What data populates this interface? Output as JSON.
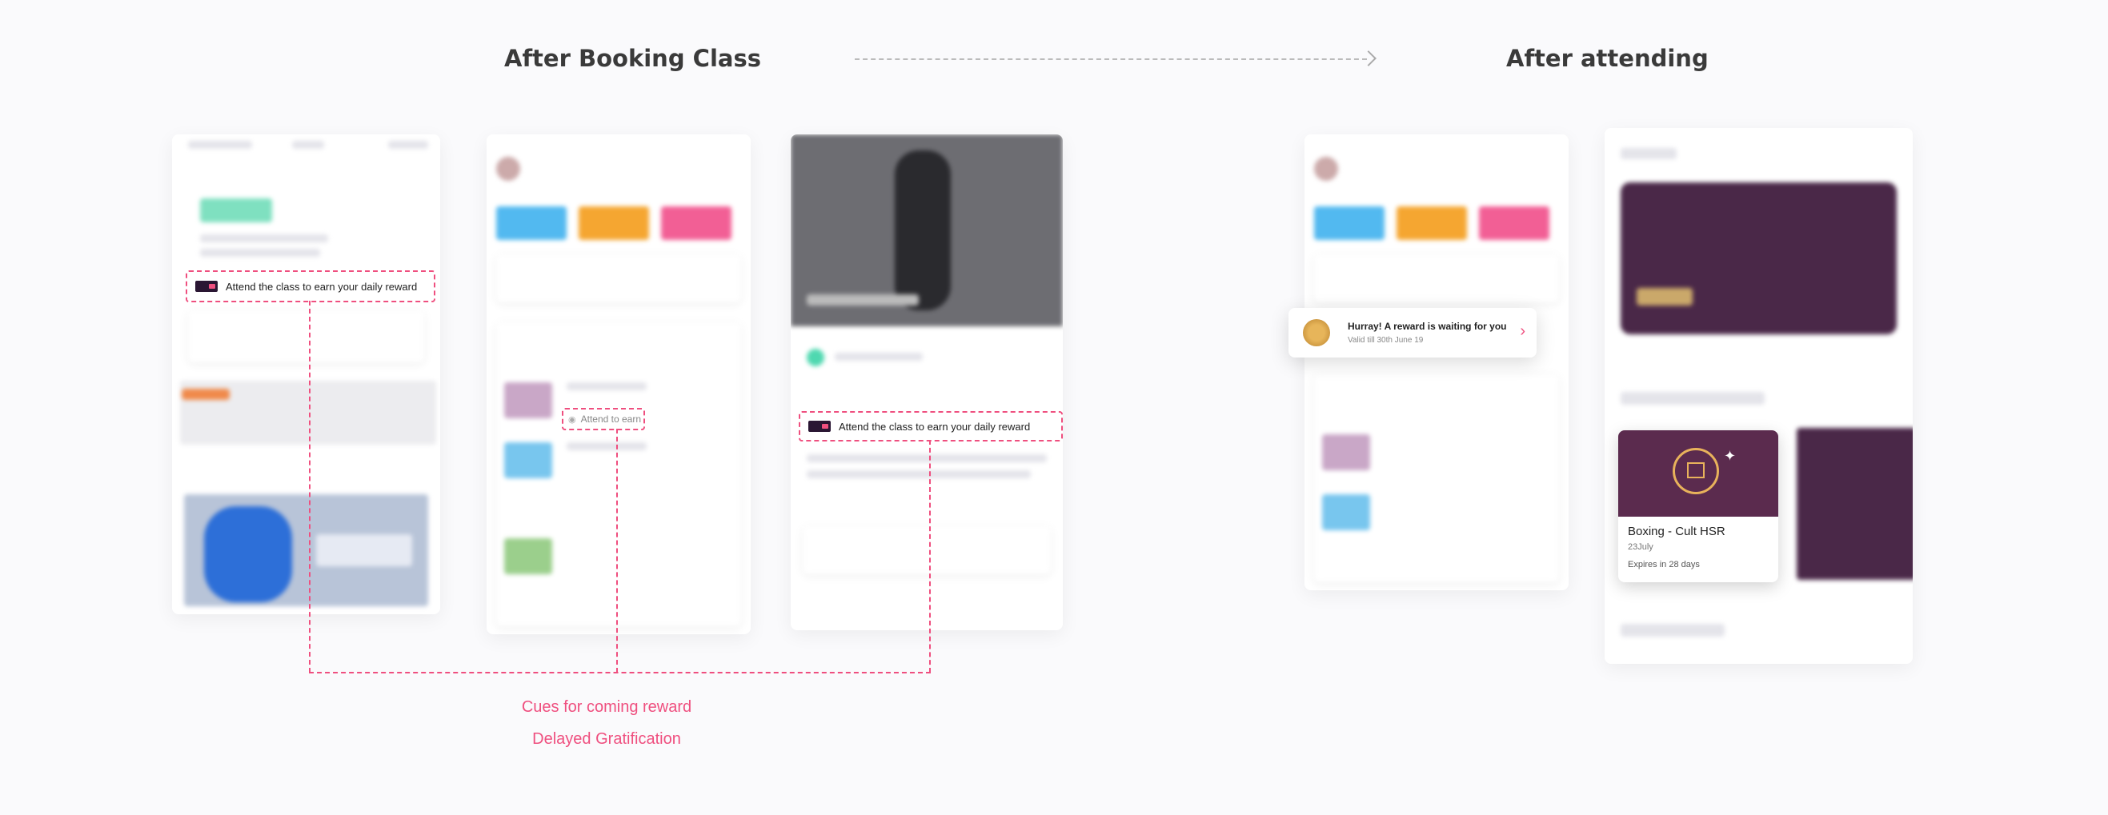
{
  "headings": {
    "after_booking": "After Booking Class",
    "after_attending": "After attending"
  },
  "cues": {
    "attend_earn_reward": "Attend the class to earn your daily reward",
    "attend_to_earn": "Attend to earn"
  },
  "captions": {
    "line1": "Cues for coming reward",
    "line2": "Delayed Gratification"
  },
  "toast": {
    "title": "Hurray! A reward is waiting for you",
    "subtitle": "Valid till 30th June 19"
  },
  "reward_card": {
    "title": "Boxing - Cult HSR",
    "date": "23July",
    "expiry": "Expires in 28 days"
  },
  "icons": [
    "chevron-right-icon",
    "medal-icon",
    "gift-icon",
    "sparkle-icon",
    "cult-logo-icon"
  ],
  "colors": {
    "accent": "#ef4f7f",
    "reward_purple": "#5b2b4e",
    "gold": "#e8b25b"
  }
}
